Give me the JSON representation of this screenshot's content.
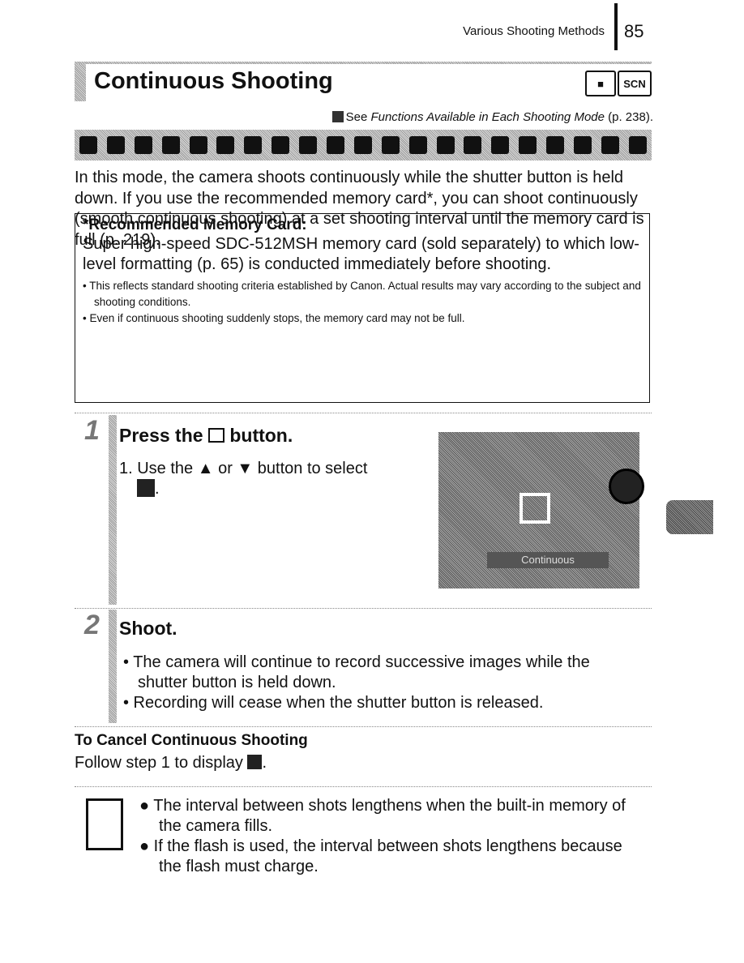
{
  "header": {
    "section": "Various Shooting Methods",
    "page": "85"
  },
  "title": "Continuous Shooting",
  "modes": [
    "camera-icon",
    "SCN"
  ],
  "see": {
    "prefix": "See ",
    "italic": "Functions Available in Each Shooting Mode",
    "suffix": " (p. 238)."
  },
  "intro": "In this mode, the camera shoots continuously while the shutter button is held down. If you use the recommended memory card*, you can shoot continuously (smooth continuous shooting) at a set shooting interval until the memory card is full (p. 219).",
  "box": {
    "heading": "*Recommended Memory Card:",
    "text": "Super high-speed SDC-512MSH memory card (sold separately) to which low-level formatting (p. 65) is conducted immediately before shooting.",
    "bullets": [
      "• This reflects standard shooting criteria established by Canon. Actual results may vary according to the subject and shooting conditions.",
      "• Even if continuous shooting suddenly stops, the memory card may not be full."
    ]
  },
  "steps": [
    {
      "num": "1",
      "title_pre": "Press the ",
      "title_post": " button.",
      "body_pre": "1. Use the ",
      "up": "▲",
      "or": " or ",
      "down": "▼",
      "body_post": " button to select",
      "lcd_label": "Continuous"
    },
    {
      "num": "2",
      "title": "Shoot.",
      "bullets": [
        "•  The camera will continue to record successive images while the shutter button is held down.",
        "•  Recording will cease when the shutter button is released."
      ]
    }
  ],
  "cancel": {
    "heading": "To Cancel Continuous Shooting",
    "text": "Follow step 1 to display "
  },
  "notes": [
    "● The interval between shots lengthens when the built-in memory of the camera fills.",
    "● If the flash is used, the interval between shots lengthens because the flash must charge."
  ]
}
